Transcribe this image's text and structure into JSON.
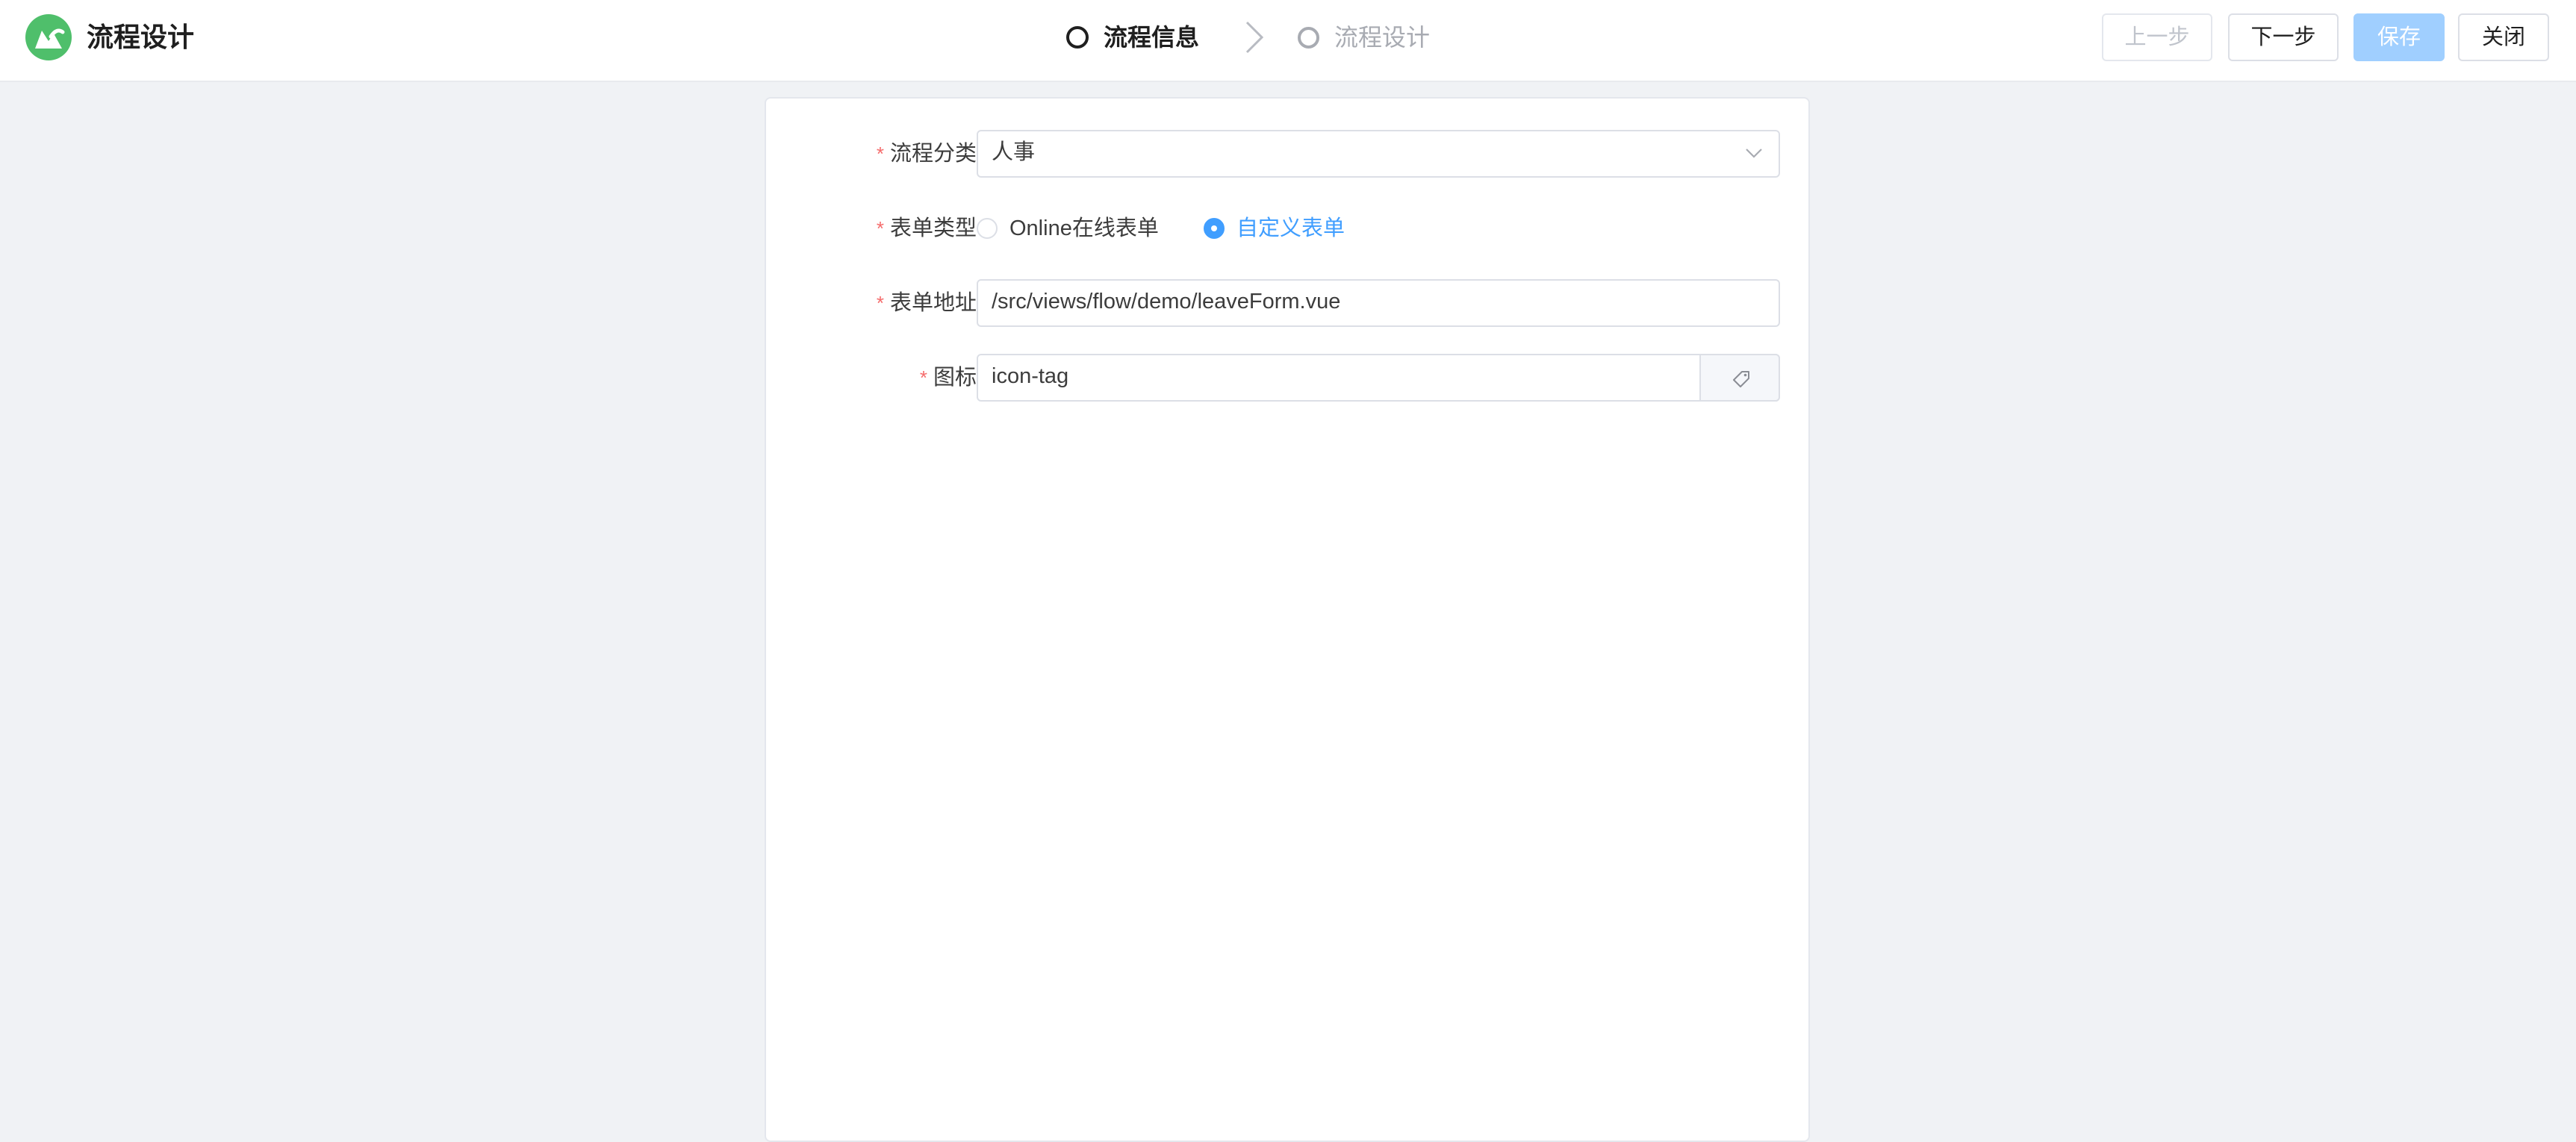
{
  "header": {
    "title": "流程设计",
    "logo_color": "#4fbf6b",
    "steps": [
      {
        "label": "流程信息",
        "state": "active"
      },
      {
        "label": "流程设计",
        "state": "inactive"
      }
    ],
    "buttons": {
      "prev": "上一步",
      "next": "下一步",
      "save": "保存",
      "close": "关闭"
    }
  },
  "form": {
    "category": {
      "label": "流程分类",
      "value": "人事",
      "icon": "chevron-down-icon"
    },
    "form_type": {
      "label": "表单类型",
      "options": [
        {
          "label": "Online在线表单",
          "checked": false
        },
        {
          "label": "自定义表单",
          "checked": true
        }
      ]
    },
    "form_url": {
      "label": "表单地址",
      "value": "/src/views/flow/demo/leaveForm.vue"
    },
    "icon": {
      "label": "图标",
      "value": "icon-tag",
      "addon_icon": "tag-icon"
    }
  },
  "colors": {
    "primary": "#409eff",
    "required": "#f56c6c",
    "save_disabled": "#a0cfff",
    "background": "#f0f2f5"
  }
}
